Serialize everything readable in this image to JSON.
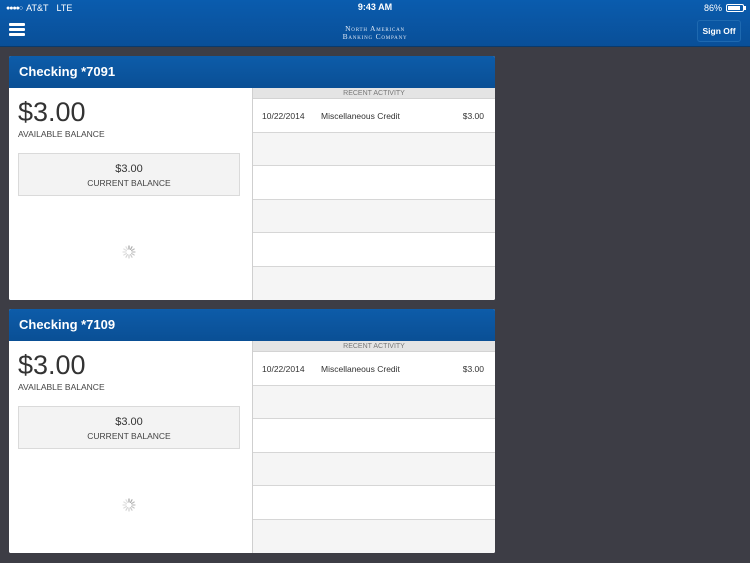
{
  "status_bar": {
    "signal_dots": "●●●●○",
    "carrier": "AT&T",
    "network": "LTE",
    "time": "9:43 AM",
    "battery_percent_label": "86%",
    "battery_level": 0.86
  },
  "header": {
    "menu_icon": "hamburger-icon",
    "logo_line1": "North American",
    "logo_line2": "Banking Company",
    "sign_off_label": "Sign Off"
  },
  "accounts": [
    {
      "title": "Checking *7091",
      "available_balance": "$3.00",
      "available_label": "AVAILABLE BALANCE",
      "current_balance": "$3.00",
      "current_label": "CURRENT BALANCE",
      "recent_activity_label": "RECENT ACTIVITY",
      "transactions": [
        {
          "date": "10/22/2014",
          "description": "Miscellaneous Credit",
          "amount": "$3.00"
        }
      ]
    },
    {
      "title": "Checking *7109",
      "available_balance": "$3.00",
      "available_label": "AVAILABLE BALANCE",
      "current_balance": "$3.00",
      "current_label": "CURRENT BALANCE",
      "recent_activity_label": "RECENT ACTIVITY",
      "transactions": [
        {
          "date": "10/22/2014",
          "description": "Miscellaneous Credit",
          "amount": "$3.00"
        }
      ]
    }
  ]
}
